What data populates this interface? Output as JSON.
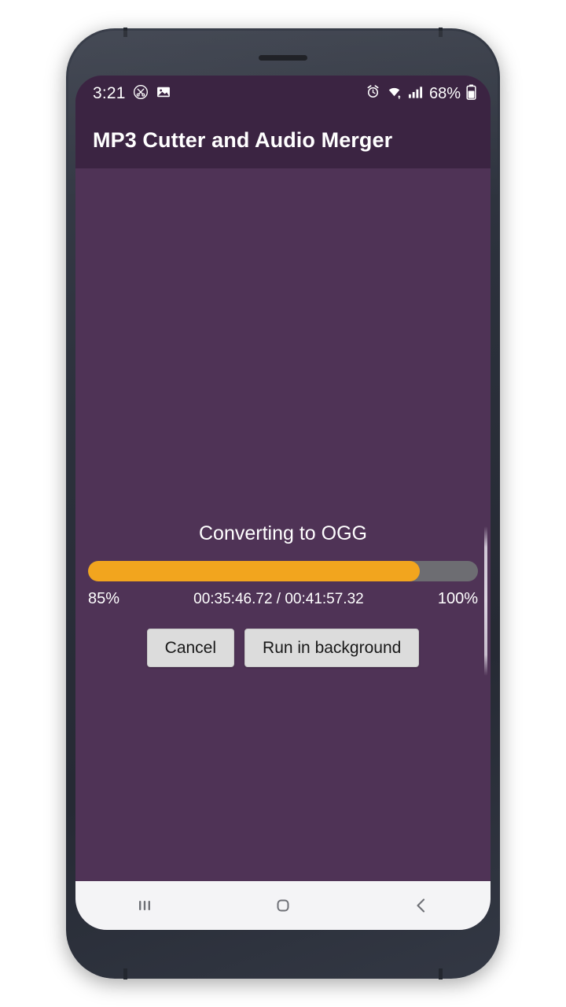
{
  "status_bar": {
    "clock": "3:21",
    "battery_percent": "68%",
    "icons": [
      "scissors-circle-icon",
      "image-icon",
      "alarm-icon",
      "wifi-icon",
      "signal-bars-icon",
      "battery-icon"
    ]
  },
  "app_bar": {
    "title": "MP3 Cutter and Audio Merger"
  },
  "progress_dialog": {
    "title": "Converting to OGG",
    "percent_label": "85%",
    "percent_value": 85,
    "max_label": "100%",
    "time_label": "00:35:46.72 / 00:41:57.32",
    "elapsed": "00:35:46.72",
    "total": "00:41:57.32",
    "buttons": {
      "cancel": "Cancel",
      "background": "Run in background"
    },
    "colors": {
      "fill": "#f2a51e",
      "track": "#6d6d72",
      "background": "#4f3356",
      "app_bar": "#3b2442"
    }
  },
  "nav_bar": {
    "recents": "recents-icon",
    "home": "home-icon",
    "back": "back-icon"
  }
}
